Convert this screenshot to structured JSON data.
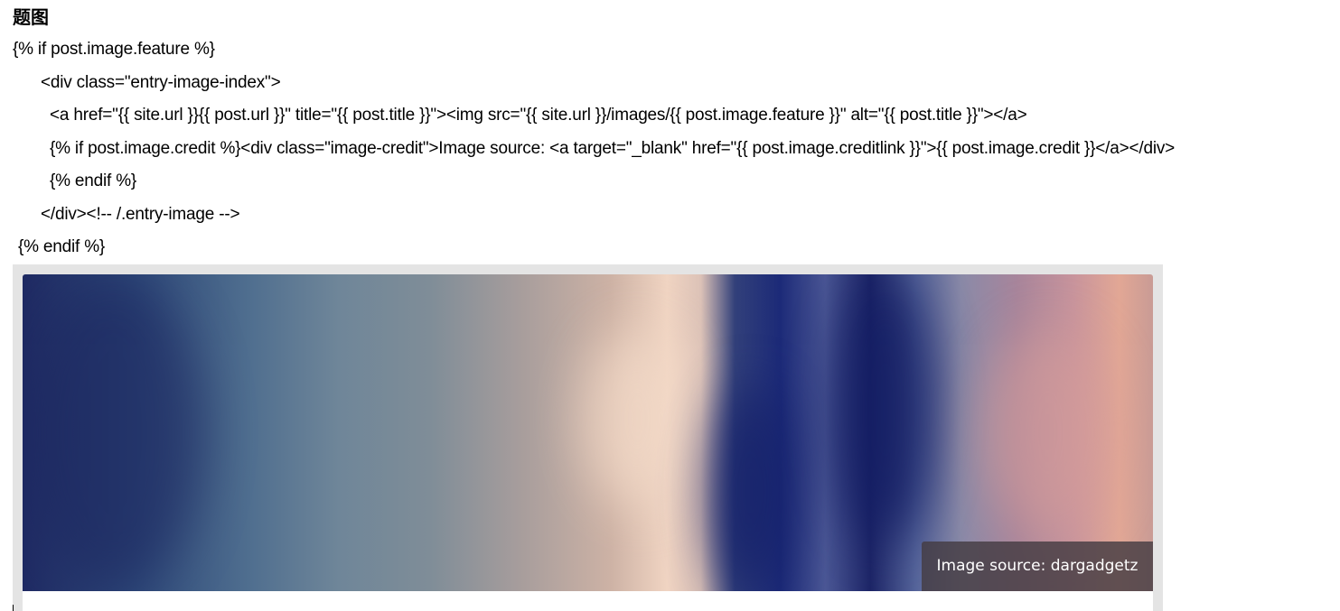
{
  "heading": "题图",
  "code_lines": [
    "{% if post.image.feature %}",
    "<div class=\"entry-image-index\">",
    "<a href=\"{{ site.url }}{{ post.url }}\" title=\"{{ post.title }}\"><img src=\"{{ site.url }}/images/{{ post.image.feature }}\" alt=\"{{ post.title }}\"></a>",
    "{% if post.image.credit %}<div class=\"image-credit\">Image source: <a target=\"_blank\" href=\"{{ post.image.creditlink }}\">{{ post.image.credit }}</a></div>",
    "{% endif %}",
    "</div><!-- /.entry-image -->",
    "{% endif %}"
  ],
  "preview": {
    "credit_prefix": "Image source: ",
    "credit_name": "dargadgetz"
  }
}
